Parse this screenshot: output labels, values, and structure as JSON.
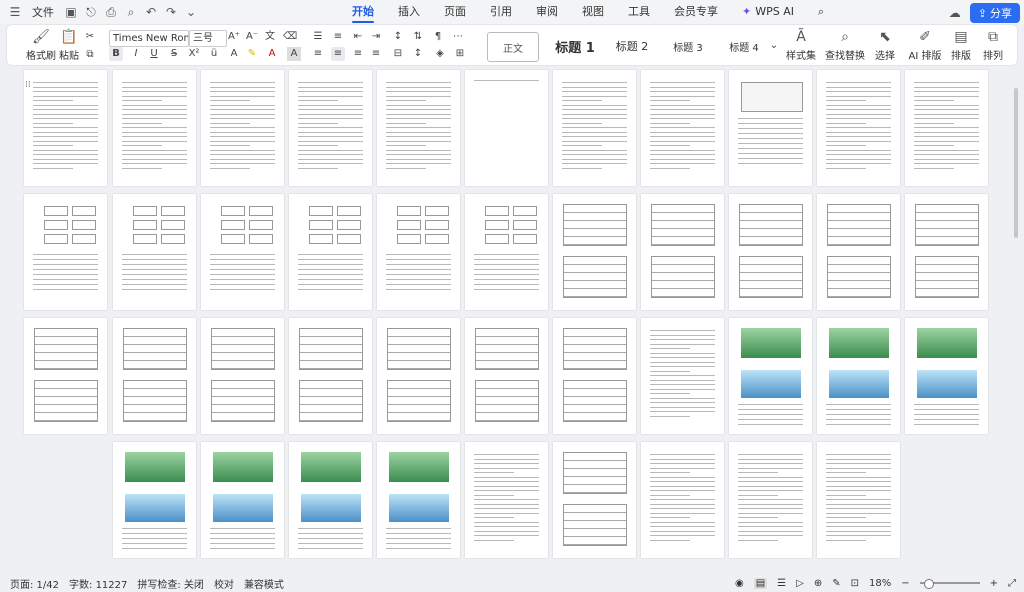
{
  "titlebar": {
    "file_label": "文件",
    "tabs": [
      {
        "label": "开始",
        "active": true
      },
      {
        "label": "插入",
        "active": false
      },
      {
        "label": "页面",
        "active": false
      },
      {
        "label": "引用",
        "active": false
      },
      {
        "label": "审阅",
        "active": false
      },
      {
        "label": "视图",
        "active": false
      },
      {
        "label": "工具",
        "active": false
      },
      {
        "label": "会员专享",
        "active": false
      }
    ],
    "wps_ai_label": "WPS AI",
    "share_label": "分享"
  },
  "ribbon": {
    "format_painter_label": "格式刷",
    "paste_label": "粘贴",
    "font_name": "Times New Romar",
    "font_size": "三号",
    "style_normal": "正文",
    "styles": [
      "标题 1",
      "标题 2",
      "标题 3",
      "标题 4"
    ],
    "style_set_label": "样式集",
    "find_replace_label": "查找替换",
    "select_label": "选择",
    "ai_layout_label": "AI 排版",
    "layout_label": "排版",
    "arrange_label": "排列",
    "bold": "B",
    "italic": "I",
    "underline": "U"
  },
  "status": {
    "page": "页面: 1/42",
    "words": "字数: 11227",
    "spell": "拼写检查: 关闭",
    "proof": "校对",
    "compat": "兼容模式",
    "zoom": "18%"
  },
  "colors": {
    "accent": "#1f5de0",
    "share_bg": "#2b6cf0"
  }
}
